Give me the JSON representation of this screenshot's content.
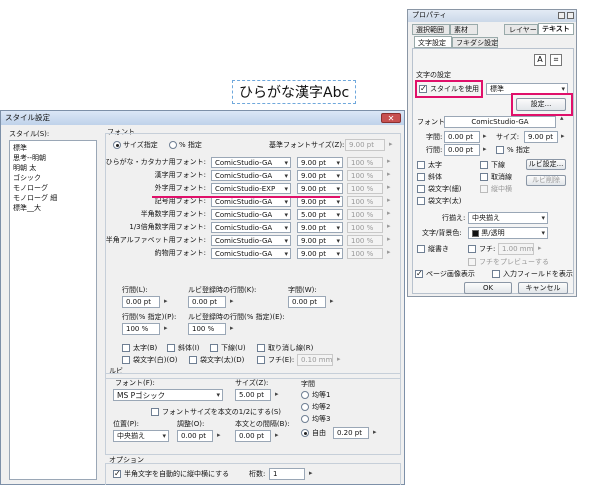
{
  "canvas_text": "ひらがな漢字Abc",
  "dialog": {
    "title": "スタイル設定",
    "close_icon": "close-icon",
    "style_list_label": "スタイル(S):",
    "styles": [
      "標準",
      "思考--明朝",
      "明朝 太",
      "ゴシック",
      "モノローグ",
      "モノローグ 細",
      "標準__大"
    ],
    "font_group": "フォント",
    "radio_size": "サイズ指定",
    "radio_percent": "% 指定",
    "base_size_label": "基準フォントサイズ(Z):",
    "base_size_value": "9.00 pt",
    "font_rows": [
      {
        "label": "ひらがな・カタカナ用フォント:",
        "font": "ComicStudio-GA",
        "size": "9.00 pt",
        "pct": "100 %"
      },
      {
        "label": "漢字用フォント:",
        "font": "ComicStudio-GA",
        "size": "9.00 pt",
        "pct": "100 %"
      },
      {
        "label": "外字用フォント:",
        "font": "ComicStudio-EXP",
        "size": "9.00 pt",
        "pct": "100 %"
      },
      {
        "label": "記号用フォント:",
        "font": "ComicStudio-GA",
        "size": "9.00 pt",
        "pct": "100 %"
      },
      {
        "label": "半角数字用フォント:",
        "font": "ComicStudio-GA",
        "size": "5.00 pt",
        "pct": "100 %"
      },
      {
        "label": "1/3倍角数字用フォント:",
        "font": "ComicStudio-GA",
        "size": "9.00 pt",
        "pct": "100 %"
      },
      {
        "label": "半角アルファベット用フォント:",
        "font": "ComicStudio-GA",
        "size": "9.00 pt",
        "pct": "100 %"
      },
      {
        "label": "約物用フォント:",
        "font": "ComicStudio-GA",
        "size": "9.00 pt",
        "pct": "100 %"
      }
    ],
    "gyokan_label": "行間(L):",
    "gyokan_value": "0.00 pt",
    "ruby_gyokan_label": "ルビ登録時の行間(K):",
    "ruby_gyokan_value": "0.00 pt",
    "jikan_label": "字間(W):",
    "jikan_value": "0.00 pt",
    "gyokan_pct_label": "行間(% 指定)(P):",
    "gyokan_pct_value": "100 %",
    "ruby_gyokan_pct_label": "ルビ登録時の行間(% 指定)(E):",
    "ruby_gyokan_pct_value": "100 %",
    "cb_bold": "太字(B)",
    "cb_italic": "斜体(I)",
    "cb_underline": "下線(U)",
    "cb_strike": "取り消し線(R)",
    "cb_outline_white": "袋文字(白)(O)",
    "cb_outline_black": "袋文字(太)(D)",
    "cb_frame": "フチ(E):",
    "frame_value": "0.10 mm",
    "ruby_group": "ルビ",
    "ruby_font_label": "フォント(F):",
    "ruby_font_value": "MS Pゴシック",
    "ruby_size_label": "サイズ(Z):",
    "ruby_size_value": "5.00 pt",
    "jikan2_label": "字間",
    "ruby_cb_same": "フォントサイズを本文の1/2にする(S)",
    "pos_label": "位置(P):",
    "pos_value": "中央揃え",
    "adjust_label": "調整(O):",
    "adjust_value": "0.00 pt",
    "body_gap_label": "本文との間隔(B):",
    "body_gap_value": "0.00 pt",
    "jikan_radios": [
      "均等1",
      "均等2",
      "均等3",
      "自由"
    ],
    "jikan_free_value": "0.20 pt",
    "option_group": "オプション",
    "opt_tate": "半角文字を自動的に縦中横にする",
    "keta_label": "桁数:",
    "keta_value": "1"
  },
  "props": {
    "title": "プロパティ",
    "tabs_row1": [
      "選択範囲",
      "素材",
      "レイヤー",
      "テキスト"
    ],
    "tabs_row2": [
      "文字設定",
      "フキダシ設定"
    ],
    "section_label": "文字の設定",
    "use_style": "スタイルを使用",
    "style_value": "標準",
    "settings_btn": "設定...",
    "font_label": "フォント:",
    "font_value": "ComicStudio-GA",
    "jikan_label": "字間:",
    "jikan_value": "0.00 pt",
    "size_label": "サイズ:",
    "size_value": "9.00 pt",
    "gyokan_label": "行間:",
    "gyokan_value": "0.00 pt",
    "pct_label": "% 指定",
    "cb_bold": "太字",
    "cb_underline": "下線",
    "ruby_btn": "ルビ設定...",
    "cb_italic": "斜体",
    "cb_strike": "取消線",
    "ruby_del_btn": "ルビ削除",
    "cb_out_thin": "袋文字(細)",
    "cb_tatechuyoko": "縦中横",
    "cb_out_thick": "袋文字(太)",
    "align_label": "行揃え:",
    "align_value": "中央揃え",
    "color_label": "文字/背景色:",
    "color_value": "黒/透明",
    "cb_vertical": "縦書き",
    "cb_fuchi": "フチ:",
    "fuchi_value": "1.00 mm",
    "fuchi_preview": "フチをプレビューする",
    "cb_page_display": "ページ画像表示",
    "cb_input_field": "入力フィールドを表示",
    "ok_btn": "OK",
    "cancel_btn": "キャンセル"
  },
  "colors": {
    "highlight": "#e0106a",
    "dialog_title_bg": "#c9daf0",
    "close_bg": "#c75050"
  }
}
